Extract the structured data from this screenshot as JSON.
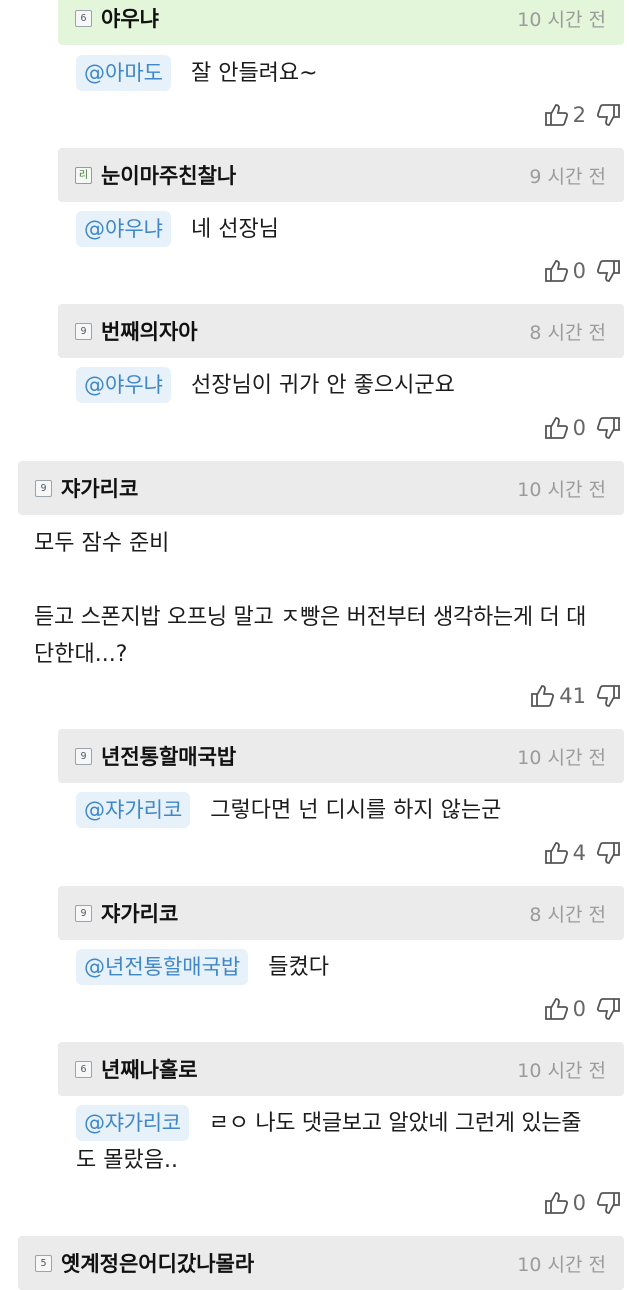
{
  "comments": [
    {
      "nick": "야우냐",
      "level": "6",
      "time": "10 시간 전",
      "mention": "@아마도",
      "text": "잘 안들려요~",
      "likes": "2"
    },
    {
      "nick": "눈이마주친찰나",
      "level": "리",
      "time": "9 시간 전",
      "mention": "@야우냐",
      "text": "네 선장님",
      "likes": "0"
    },
    {
      "nick": "번째의자아",
      "level": "9",
      "time": "8 시간 전",
      "mention": "@야우냐",
      "text": "선장님이 귀가 안 좋으시군요",
      "likes": "0"
    },
    {
      "nick": "쟈가리코",
      "level": "9",
      "time": "10 시간 전",
      "text": "모두 잠수 준비",
      "text2": "듣고 스폰지밥 오프닝 말고 ㅈ빵은 버전부터 생각하는게 더 대",
      "text3": "단한대...?",
      "likes": "41"
    },
    {
      "nick": "년전통할매국밥",
      "level": "9",
      "time": "10 시간 전",
      "mention": "@쟈가리코",
      "text": "그렇다면 넌 디시를 하지 않는군",
      "likes": "4"
    },
    {
      "nick": "쟈가리코",
      "level": "9",
      "time": "8 시간 전",
      "mention": "@년전통할매국밥",
      "text": "들켰다",
      "likes": "0"
    },
    {
      "nick": "년째나홀로",
      "level": "6",
      "time": "10 시간 전",
      "mention": "@쟈가리코",
      "text": "ㄹㅇ 나도 댓글보고 알았네 그런게 있는줄",
      "text2": "도 몰랐음..",
      "likes": "0"
    },
    {
      "nick": "옛계정은어디갔나몰라",
      "level": "5",
      "time": "10 시간 전"
    }
  ]
}
